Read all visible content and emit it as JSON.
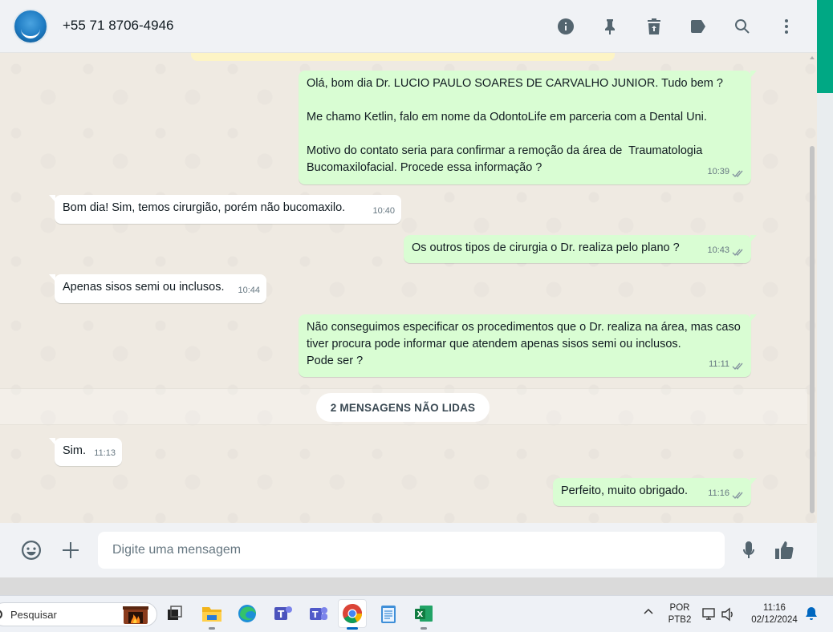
{
  "header": {
    "contact_name": "+55 71 8706-4946",
    "icons": [
      "info-icon",
      "pin-icon",
      "delete-icon",
      "label-icon",
      "search-icon",
      "menu-icon"
    ]
  },
  "messages": [
    {
      "direction": "out",
      "text": "Olá, bom dia Dr. LUCIO PAULO SOARES DE CARVALHO JUNIOR. Tudo bem ?\n\nMe chamo Ketlin, falo em nome da OdontoLife em parceria com a Dental Uni.\n\nMotivo do contato seria para confirmar a remoção da área de  Traumatologia Bucomaxilofacial. Procede essa informação ?",
      "time": "10:39",
      "read": true
    },
    {
      "direction": "in",
      "text": "Bom dia! Sim, temos cirurgião, porém não bucomaxilo.",
      "time": "10:40"
    },
    {
      "direction": "out",
      "text": "Os outros tipos de cirurgia o Dr. realiza pelo plano ?",
      "time": "10:43",
      "read": true
    },
    {
      "direction": "in",
      "text": "Apenas sisos semi ou inclusos.",
      "time": "10:44"
    },
    {
      "direction": "out",
      "text": "Não conseguimos especificar os procedimentos que o Dr. realiza na área, mas caso tiver procura pode informar que atendem apenas sisos semi ou inclusos.\nPode ser ?",
      "time": "11:11",
      "read": true
    },
    {
      "direction": "in",
      "text": "Sim.",
      "time": "11:13"
    },
    {
      "direction": "out",
      "text": "Perfeito, muito obrigado.",
      "time": "11:16",
      "read": true
    }
  ],
  "unread_label": "2 MENSAGENS NÃO LIDAS",
  "composer": {
    "placeholder": "Digite uma mensagem",
    "icons": [
      "emoji-icon",
      "attach-plus-icon",
      "microphone-icon",
      "thumbs-up-icon"
    ]
  },
  "taskbar": {
    "search_label": "Pesquisar",
    "apps": [
      "task-view",
      "file-explorer",
      "edge",
      "teams-work",
      "teams",
      "chrome",
      "notepad",
      "excel"
    ],
    "active_app": "chrome",
    "lang_line1": "POR",
    "lang_line2": "PTB2",
    "time": "11:16",
    "date": "02/12/2024"
  },
  "colors": {
    "outgoing_bubble": "#d9fdd3",
    "incoming_bubble": "#ffffff",
    "accent": "#00a884",
    "chat_bg": "#efeae2"
  }
}
